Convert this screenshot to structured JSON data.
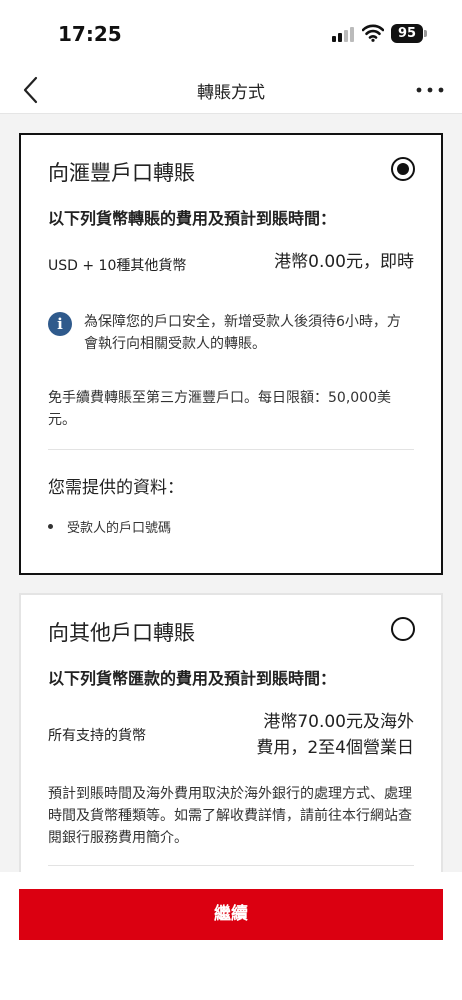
{
  "status_bar": {
    "time": "17:25",
    "battery": "95"
  },
  "nav": {
    "title": "轉賬方式"
  },
  "options": [
    {
      "title": "向滙豐戶口轉賬",
      "selected": true,
      "fee_heading": "以下列貨幣轉賬的費用及預計到賬時間：",
      "currency_label": "USD + 10種其他貨幣",
      "fee_value": "港幣0.00元，即時",
      "info_notice": "為保障您的戶口安全，新增受款人後須待6小時，方會執行向相關受款人的轉賬。",
      "description": "免手續費轉賬至第三方滙豐戶口。每日限額：50,000美元。",
      "required_heading": "您需提供的資料：",
      "required_items": [
        "受款人的戶口號碼"
      ]
    },
    {
      "title": "向其他戶口轉賬",
      "selected": false,
      "fee_heading": "以下列貨幣匯款的費用及預計到賬時間：",
      "currency_label": "所有支持的貨幣",
      "fee_value_line1": "港幣70.00元及海外",
      "fee_value_line2": "費用，2至4個營業日",
      "description": "預計到賬時間及海外費用取決於海外銀行的處理方式、處理時間及貨幣種類等。如需了解收費詳情，請前往本行網站查閱銀行服務費用簡介。"
    }
  ],
  "footer": {
    "continue_label": "繼續"
  },
  "colors": {
    "brand_red": "#db0011",
    "info_blue": "#2f5a8c"
  }
}
